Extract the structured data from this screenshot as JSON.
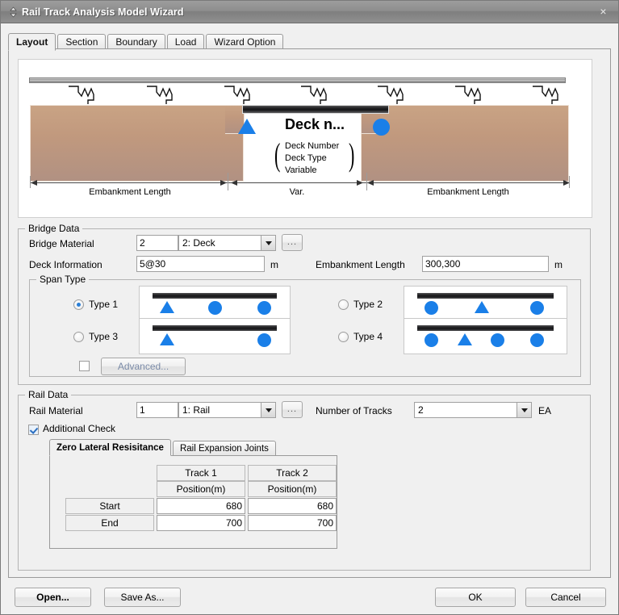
{
  "window": {
    "title": "Rail Track Analysis Model Wizard",
    "close_label": "×",
    "sysicon": "updown-arrow-icon"
  },
  "tabs": [
    {
      "label": "Layout",
      "active": true
    },
    {
      "label": "Section",
      "active": false
    },
    {
      "label": "Boundary",
      "active": false
    },
    {
      "label": "Load",
      "active": false
    },
    {
      "label": "Wizard Option",
      "active": false
    }
  ],
  "diagram": {
    "deck_title": "Deck n...",
    "deck_sub_lines": [
      "Deck Number",
      "Deck Type",
      "Variable"
    ],
    "brace_left": "(",
    "brace_right": ")",
    "dim_left": "Embankment Length",
    "dim_mid": "Var.",
    "dim_right": "Embankment Length",
    "colors": {
      "support": "#1a7fe8",
      "embankment_top": "#c9a384",
      "embankment_bottom": "#b19182",
      "deck": "#17171a"
    }
  },
  "bridge_data": {
    "group_title": "Bridge Data",
    "material_label": "Bridge Material",
    "material_id": "2",
    "material_name": "2: Deck",
    "material_browse": "...",
    "deck_info_label": "Deck Information",
    "deck_info_value": "5@30",
    "deck_info_unit": "m",
    "embankment_label": "Embankment Length",
    "embankment_value": "300,300",
    "embankment_unit": "m",
    "span_type": {
      "group_title": "Span Type",
      "selected": "Type 1",
      "options": [
        {
          "label": "Type 1",
          "checked": true,
          "supports": [
            "triangle",
            "circle",
            "circle"
          ]
        },
        {
          "label": "Type 2",
          "checked": false,
          "supports": [
            "circle",
            "triangle",
            "circle"
          ]
        },
        {
          "label": "Type 3",
          "checked": false,
          "supports": [
            "triangle",
            "circle"
          ]
        },
        {
          "label": "Type 4",
          "checked": false,
          "supports": [
            "circle",
            "triangle",
            "circle",
            "circle"
          ]
        }
      ],
      "advanced_label": "Advanced...",
      "advanced_checked": false
    }
  },
  "rail_data": {
    "group_title": "Rail Data",
    "material_label": "Rail Material",
    "material_id": "1",
    "material_name": "1: Rail",
    "material_browse": "...",
    "tracks_label": "Number of Tracks",
    "tracks_value": "2",
    "tracks_unit": "EA",
    "additional_check_label": "Additional Check",
    "additional_check_checked": true,
    "inner_tabs": [
      {
        "label": "Zero Lateral Resisitance",
        "active": true
      },
      {
        "label": "Rail Expansion Joints",
        "active": false
      }
    ],
    "table": {
      "track_headers": [
        "Track 1",
        "Track 2"
      ],
      "sub_headers": [
        "Position(m)",
        "Position(m)"
      ],
      "rows": [
        {
          "label": "Start",
          "values": [
            "680",
            "680"
          ]
        },
        {
          "label": "End",
          "values": [
            "700",
            "700"
          ]
        }
      ]
    }
  },
  "footer": {
    "open_label": "Open...",
    "save_as_label": "Save As...",
    "ok_label": "OK",
    "cancel_label": "Cancel"
  }
}
